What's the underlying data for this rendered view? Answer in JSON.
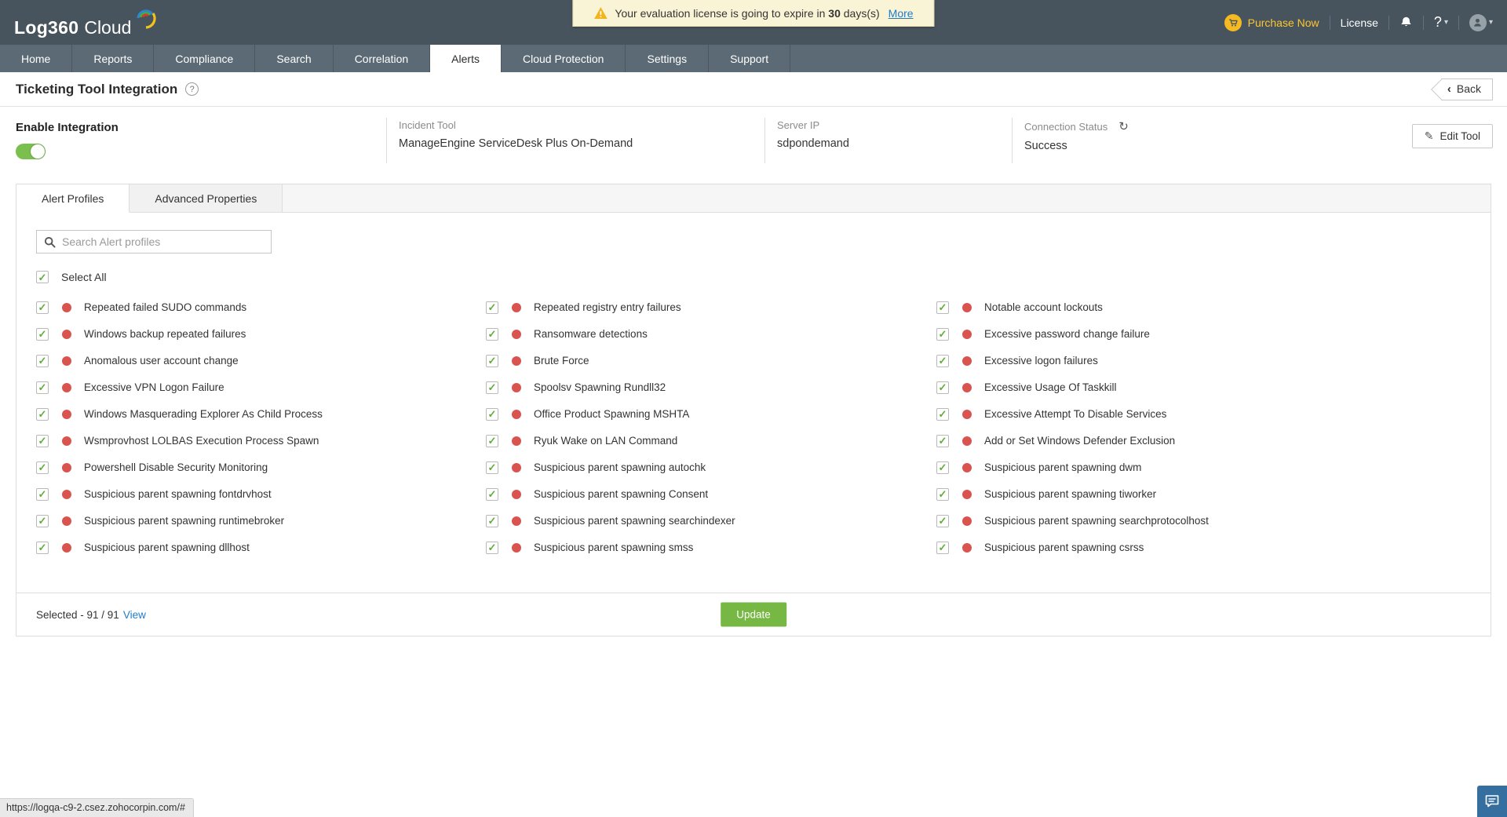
{
  "topbar": {
    "logo_main": "Log360",
    "logo_sub": "Cloud",
    "license_banner": {
      "text_before": "Your evaluation license is going to expire in",
      "days": "30",
      "text_after": "days(s)",
      "link": "More"
    },
    "purchase_now": "Purchase Now",
    "license": "License",
    "help_glyph": "?"
  },
  "nav": {
    "tabs": [
      "Home",
      "Reports",
      "Compliance",
      "Search",
      "Correlation",
      "Alerts",
      "Cloud Protection",
      "Settings",
      "Support"
    ],
    "active_tab": "Alerts"
  },
  "page": {
    "title": "Ticketing Tool Integration",
    "help_glyph": "?",
    "back_label": "Back"
  },
  "integration": {
    "enable_label": "Enable Integration",
    "toggle_state": "on",
    "fields": [
      {
        "label": "Incident Tool",
        "value": "ManageEngine ServiceDesk Plus On-Demand"
      },
      {
        "label": "Server IP",
        "value": "sdpondemand"
      },
      {
        "label": "Connection Status",
        "value": "Success"
      }
    ],
    "edit_tool_label": "Edit Tool"
  },
  "panel": {
    "tabs": [
      "Alert Profiles",
      "Advanced Properties"
    ],
    "active_tab": "Alert Profiles",
    "search_placeholder": "Search Alert profiles",
    "select_all_label": "Select All",
    "columns": [
      [
        "Repeated failed SUDO commands",
        "Windows backup repeated failures",
        "Anomalous user account change",
        "Excessive VPN Logon Failure",
        "Windows Masquerading Explorer As Child Process",
        "Wsmprovhost LOLBAS Execution Process Spawn",
        "Powershell Disable Security Monitoring",
        "Suspicious parent spawning fontdrvhost",
        "Suspicious parent spawning runtimebroker",
        "Suspicious parent spawning dllhost"
      ],
      [
        "Repeated registry entry failures",
        "Ransomware detections",
        "Brute Force",
        "Spoolsv Spawning Rundll32",
        "Office Product Spawning MSHTA",
        "Ryuk Wake on LAN Command",
        "Suspicious parent spawning autochk",
        "Suspicious parent spawning Consent",
        "Suspicious parent spawning searchindexer",
        "Suspicious parent spawning smss"
      ],
      [
        "Notable account lockouts",
        "Excessive password change failure",
        "Excessive logon failures",
        "Excessive Usage Of Taskkill",
        "Excessive Attempt To Disable Services",
        "Add or Set Windows Defender Exclusion",
        "Suspicious parent spawning dwm",
        "Suspicious parent spawning tiworker",
        "Suspicious parent spawning searchprotocolhost",
        "Suspicious parent spawning csrss"
      ]
    ],
    "footer": {
      "selected_label": "Selected - 91 / 91",
      "view_link": "View",
      "update_label": "Update"
    }
  },
  "status_bar": {
    "url": "https://logqa-c9-2.csez.zohocorpin.com/#"
  },
  "icons": {
    "check": "✓",
    "back_chevron": "‹",
    "refresh": "↻",
    "pencil": "✎",
    "caret": "▾"
  },
  "colors": {
    "header_bg": "#47545d",
    "nav_bg": "#5b6a74",
    "toggle_green": "#7bbf4e",
    "check_green": "#5fae3d",
    "severity_red": "#d9534f",
    "update_green": "#76b843",
    "link_blue": "#1f7bc9",
    "purchase_yellow": "#fdc62f",
    "banner_bg": "#faf4d7",
    "chat_blue": "#356f9f"
  }
}
